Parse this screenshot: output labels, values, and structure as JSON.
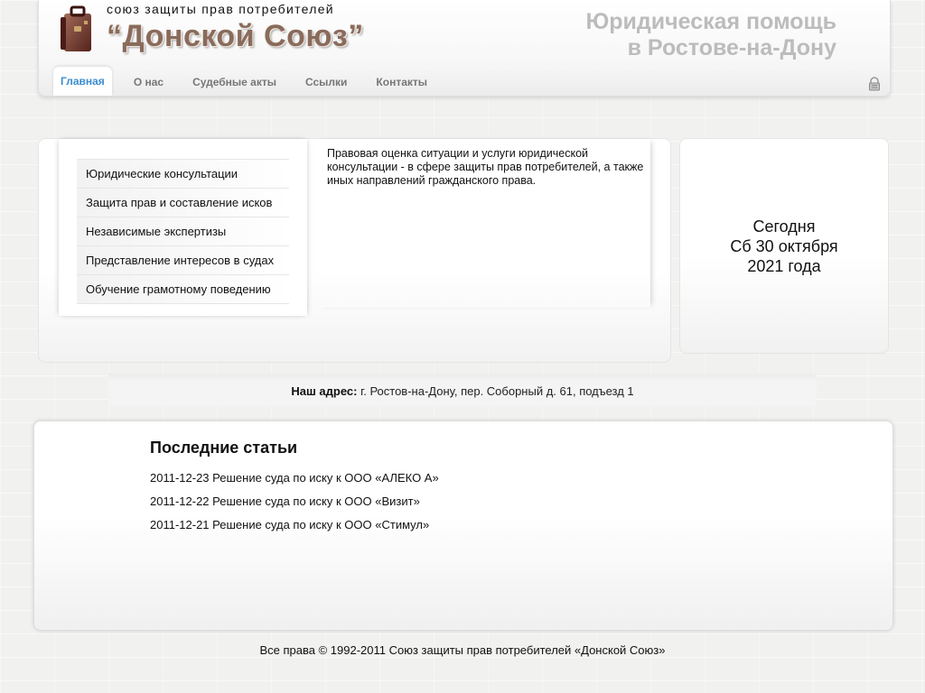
{
  "header": {
    "tagline": "союз защиты прав потребителей",
    "name": "“Донской Союз”",
    "slogan_line1": "Юридическая помощь",
    "slogan_line2": "в Ростове-на-Дону",
    "icons": {
      "logo": "briefcase-icon",
      "login": "lock-icon"
    },
    "nav": [
      {
        "label": "Главная",
        "active": true
      },
      {
        "label": "О нас"
      },
      {
        "label": "Судебные акты"
      },
      {
        "label": "Ссылки"
      },
      {
        "label": "Контакты"
      }
    ]
  },
  "services": [
    "Юридические консультации",
    "Защита прав и составление исков",
    "Независимые экспертизы",
    "Представление интересов в судах",
    "Обучение грамотному поведению"
  ],
  "intro_text": "Правовая оценка ситуации и услуги юридической консультации - в сфере защиты прав потребителей, а также иных направлений гражданского права.",
  "today": {
    "label": "Сегодня",
    "date": "Сб 30 октября",
    "year": "2021 года"
  },
  "address": {
    "label": "Наш адрес:",
    "value": "г. Ростов-на-Дону, пер. Соборный д. 61, подъезд 1"
  },
  "articles": {
    "title": "Последние статьи",
    "items": [
      "2011-12-23 Решение суда по иску к ООО «АЛЕКО А»",
      "2011-12-22 Решение суда по иску к ООО «Визит»",
      "2011-12-21 Решение суда по иску к ООО «Стимул»"
    ]
  },
  "footer": "Все права © 1992-2011 Союз защиты прав потребителей «Донской Союз»",
  "colors": {
    "accent": "#3b8dd0",
    "brand": "#8a6b5b",
    "slogan": "#bcbcbc"
  }
}
